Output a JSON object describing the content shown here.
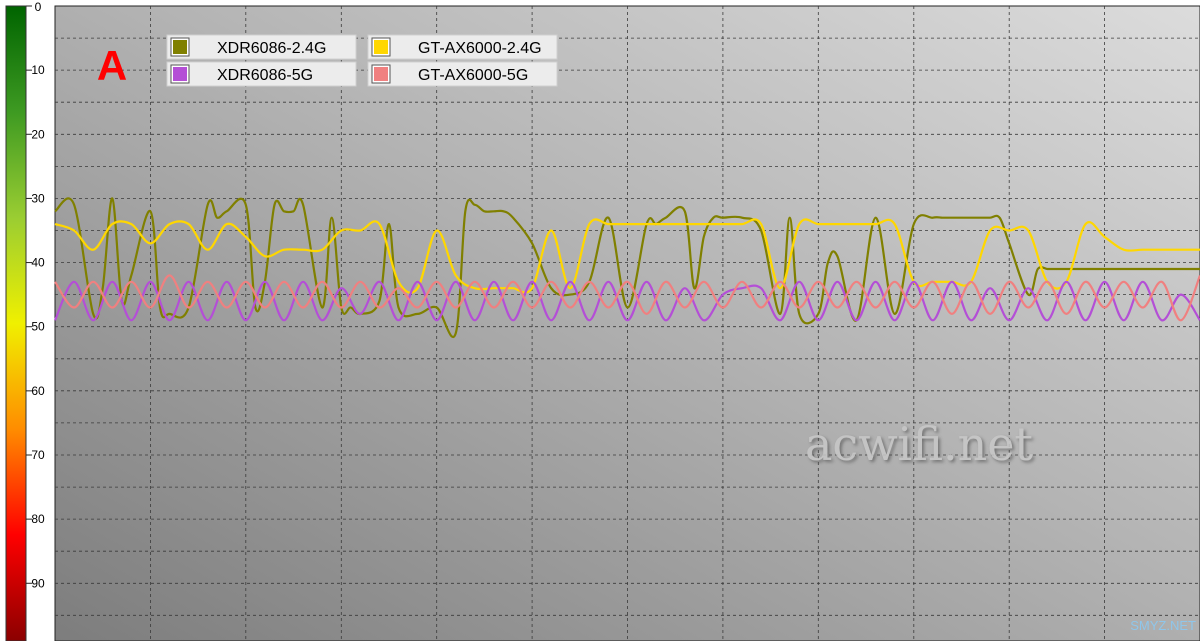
{
  "chart_data": {
    "type": "line",
    "panel_label": "A",
    "y_axis": {
      "range": [
        0,
        99
      ],
      "inverted": true,
      "tick_labels": [
        "0",
        "10",
        "20",
        "30",
        "40",
        "50",
        "60",
        "70",
        "80",
        "90"
      ],
      "color_scale": [
        "#006400",
        "#3e9a22",
        "#9acd32",
        "#f0f000",
        "#ff8c00",
        "#ff0000",
        "#8b0000"
      ]
    },
    "x_axis": {
      "range": [
        0,
        60
      ],
      "tick_labels": []
    },
    "grid": true,
    "legend_position": "top-left",
    "series": [
      {
        "name": "XDR6086-2.4G",
        "color": "#808000",
        "x": [
          0,
          1,
          2,
          2.5,
          3,
          3.5,
          4,
          5,
          5.5,
          6,
          7,
          8,
          8.5,
          9,
          10,
          10.5,
          11,
          11.5,
          12,
          12.5,
          13,
          14,
          14.5,
          15,
          15.5,
          16,
          17,
          17.5,
          18,
          19,
          20,
          21,
          21.5,
          22,
          22.5,
          23,
          23.5,
          24,
          25,
          26,
          27,
          28,
          29,
          30,
          31,
          31.5,
          32,
          33,
          33.5,
          34,
          34.5,
          35,
          36,
          37,
          38,
          38.5,
          39,
          40,
          40.5,
          41,
          42,
          43,
          44,
          45,
          46,
          46.5,
          47,
          48,
          48.5,
          49,
          49.5,
          50,
          51,
          51.5,
          52,
          52.5,
          53,
          54,
          55,
          56,
          57,
          57.5,
          58,
          59,
          60
        ],
        "values": [
          32,
          31,
          48,
          44,
          30,
          46,
          42,
          32,
          47,
          48,
          47,
          31,
          33,
          32,
          31,
          47,
          43,
          31,
          32,
          32,
          31,
          47,
          33,
          47,
          47,
          48,
          46,
          34,
          47,
          48,
          47,
          51,
          32,
          31,
          32,
          32,
          32,
          33,
          37,
          44,
          45,
          43,
          33,
          47,
          34,
          34,
          33,
          32,
          44,
          36,
          33,
          33,
          33,
          35,
          48,
          33,
          48,
          48,
          40,
          39,
          49,
          33,
          48,
          34,
          33,
          33,
          33,
          33,
          33,
          33,
          33,
          37,
          45,
          41,
          41,
          41,
          41,
          41,
          41,
          41,
          41,
          41,
          41,
          41,
          41
        ]
      },
      {
        "name": "GT-AX6000-2.4G",
        "color": "#ffd700",
        "x": [
          0,
          1,
          2,
          3,
          4,
          5,
          6,
          7,
          8,
          9,
          10,
          11,
          12,
          13,
          14,
          15,
          16,
          17,
          18,
          19,
          20,
          21,
          22,
          23,
          23.5,
          24,
          25,
          26,
          27,
          28,
          29,
          30,
          31,
          32,
          33,
          34,
          35,
          36,
          37,
          38,
          39,
          40,
          41,
          42,
          43,
          44,
          45,
          46,
          47,
          48,
          49,
          50,
          51,
          52,
          53,
          54,
          55,
          56,
          57,
          58,
          59,
          60
        ],
        "values": [
          34,
          35,
          38,
          34,
          34,
          37,
          34,
          34,
          38,
          34,
          36,
          39,
          38,
          38,
          38,
          35,
          35,
          34,
          43,
          44,
          35,
          42,
          44,
          44,
          44,
          44,
          44,
          35,
          44,
          34,
          34,
          34,
          34,
          34,
          34,
          34,
          34,
          34,
          34,
          44,
          34,
          34,
          34,
          34,
          34,
          34,
          43,
          43,
          43,
          43,
          35,
          35,
          35,
          43,
          43,
          34,
          36,
          38,
          38,
          38,
          38,
          38
        ]
      },
      {
        "name": "XDR6086-5G",
        "color": "#b44fd6",
        "x": [
          0,
          1,
          2,
          3,
          4,
          5,
          6,
          7,
          8,
          9,
          10,
          11,
          12,
          13,
          14,
          15,
          16,
          17,
          18,
          19,
          20,
          21,
          22,
          23,
          24,
          25,
          26,
          27,
          28,
          29,
          30,
          31,
          32,
          33,
          34,
          35,
          36,
          37,
          38,
          39,
          40,
          41,
          42,
          43,
          44,
          45,
          46,
          47,
          48,
          49,
          50,
          51,
          52,
          53,
          54,
          55,
          56,
          57,
          58,
          59,
          60
        ],
        "values": [
          49,
          43,
          49,
          43,
          49,
          43,
          49,
          43,
          49,
          43,
          49,
          43,
          49,
          43,
          49,
          44,
          48,
          43,
          49,
          43,
          49,
          43,
          49,
          43,
          49,
          43,
          49,
          43,
          49,
          43,
          49,
          43,
          49,
          44,
          49,
          45,
          44,
          44,
          49,
          43,
          49,
          43,
          49,
          43,
          49,
          43,
          49,
          43,
          49,
          44,
          49,
          44,
          49,
          43,
          49,
          43,
          49,
          43,
          49,
          45,
          49
        ]
      },
      {
        "name": "GT-AX6000-5G",
        "color": "#f08080",
        "x": [
          0,
          1,
          2,
          3,
          4,
          5,
          6,
          7,
          8,
          9,
          10,
          11,
          12,
          13,
          14,
          15,
          16,
          17,
          18,
          19,
          20,
          21,
          22,
          23,
          24,
          25,
          26,
          27,
          28,
          29,
          30,
          31,
          32,
          33,
          34,
          35,
          36,
          37,
          38,
          39,
          40,
          41,
          42,
          43,
          44,
          45,
          46,
          47,
          48,
          49,
          50,
          51,
          52,
          53,
          54,
          55,
          56,
          57,
          58,
          59,
          60
        ],
        "values": [
          43,
          47,
          43,
          47,
          43,
          47,
          42,
          47,
          43,
          47,
          43,
          47,
          43,
          47,
          43,
          47,
          43,
          47,
          44,
          47,
          43,
          47,
          43,
          47,
          43,
          47,
          43,
          47,
          43,
          47,
          43,
          48,
          43,
          47,
          43,
          47,
          43,
          47,
          43,
          47,
          43,
          47,
          43,
          47,
          43,
          47,
          43,
          48,
          43,
          48,
          43,
          47,
          43,
          48,
          43,
          47,
          43,
          47,
          43,
          49,
          42
        ]
      }
    ]
  },
  "watermark": "acwifi.net",
  "corner_mark": "SMYZ.NET"
}
